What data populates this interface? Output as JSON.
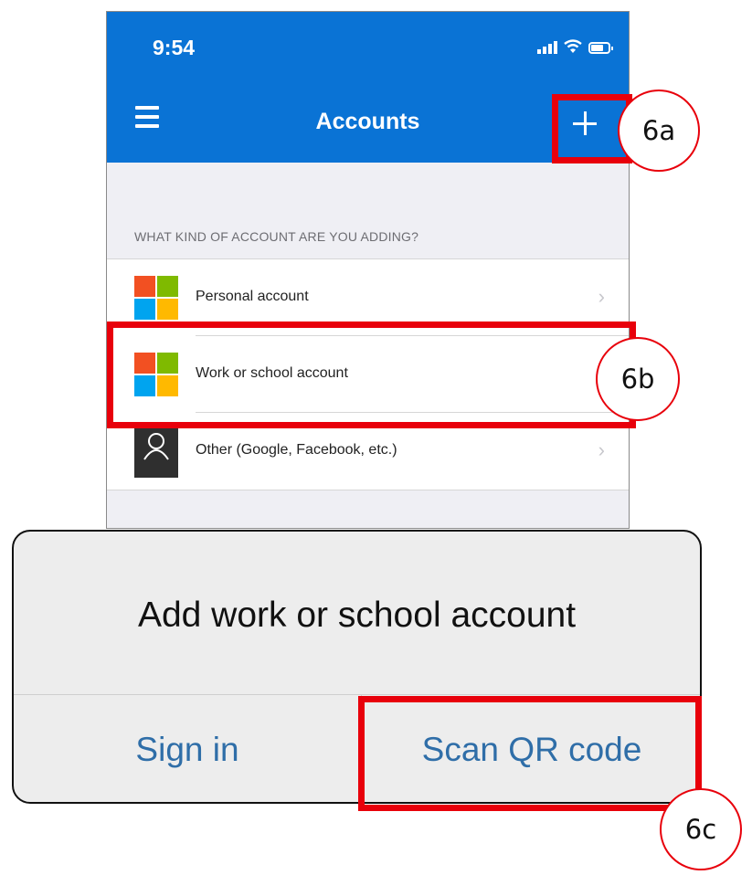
{
  "status_bar": {
    "time": "9:54",
    "icons": [
      "signal-icon",
      "wifi-icon",
      "battery-icon"
    ]
  },
  "nav": {
    "title": "Accounts",
    "menu_icon": "hamburger-icon",
    "add_icon": "plus-icon"
  },
  "section_header": "WHAT KIND OF ACCOUNT ARE YOU ADDING?",
  "account_types": [
    {
      "label": "Personal account",
      "icon": "microsoft-logo-icon"
    },
    {
      "label": "Work or school account",
      "icon": "microsoft-logo-icon"
    },
    {
      "label": "Other (Google, Facebook, etc.)",
      "icon": "person-icon"
    }
  ],
  "dialog": {
    "title": "Add work or school account",
    "sign_in_label": "Sign in",
    "scan_qr_label": "Scan QR code"
  },
  "callouts": {
    "a": "6a",
    "b": "6b",
    "c": "6c"
  },
  "colors": {
    "app_blue": "#0a73d5",
    "callout_red": "#e8000b",
    "dialog_button_blue": "#2f6ea8",
    "ms_red": "#f25022",
    "ms_green": "#7fba00",
    "ms_blue": "#00a4ef",
    "ms_yellow": "#ffb900"
  }
}
